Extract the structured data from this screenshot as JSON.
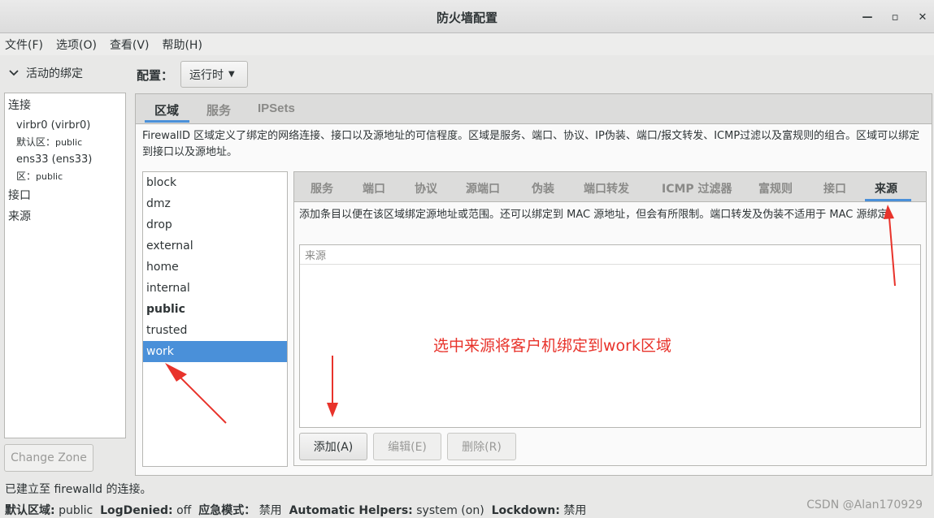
{
  "window": {
    "title": "防火墙配置"
  },
  "menu": [
    "文件(F)",
    "选项(O)",
    "查看(V)",
    "帮助(H)"
  ],
  "left_pane": {
    "header": "活动的绑定",
    "connections_label": "连接",
    "connections": [
      {
        "name": "virbr0 (virbr0)",
        "zone_label": "默认区：",
        "zone": "public"
      },
      {
        "name": "ens33 (ens33)",
        "zone_label": "区：",
        "zone": "public"
      }
    ],
    "interfaces_label": "接口",
    "sources_label": "来源",
    "change_zone": "Change Zone"
  },
  "config": {
    "label": "配置：",
    "value": "运行时"
  },
  "main_tabs": [
    "区域",
    "服务",
    "IPSets"
  ],
  "zone_description": "FirewallD 区域定义了绑定的网络连接、接口以及源地址的可信程度。区域是服务、端口、协议、IP伪装、端口/报文转发、ICMP过滤以及富规则的组合。区域可以绑定到接口以及源地址。",
  "zones": [
    "block",
    "dmz",
    "drop",
    "external",
    "home",
    "internal",
    "public",
    "trusted",
    "work"
  ],
  "zone_default": "public",
  "zone_selected": "work",
  "sub_tabs": [
    "服务",
    "端口",
    "协议",
    "源端口",
    "伪装",
    "端口转发",
    "ICMP 过滤器",
    "富规则",
    "接口",
    "来源"
  ],
  "sub_tab_active": "来源",
  "sources_description": "添加条目以便在该区域绑定源地址或范围。还可以绑定到  MAC 源地址，但会有所限制。端口转发及伪装不适用于 MAC 源绑定。",
  "sources_column": "来源",
  "buttons": {
    "add": "添加(A)",
    "edit": "编辑(E)",
    "remove": "删除(R)"
  },
  "status": {
    "line1": "已建立至  firewalld 的连接。",
    "default_zone_label": "默认区域:",
    "default_zone": "public",
    "log_denied_label": "LogDenied:",
    "log_denied": "off",
    "panic_label": "应急模式：",
    "panic": "禁用",
    "helpers_label": "Automatic Helpers:",
    "helpers": "system (on)",
    "lockdown_label": "Lockdown:",
    "lockdown": "禁用"
  },
  "annotation": "选中来源将客户机绑定到work区域",
  "watermark": "CSDN @Alan170929",
  "colors": {
    "accent": "#4a90d9",
    "annotation": "#e8332b"
  }
}
